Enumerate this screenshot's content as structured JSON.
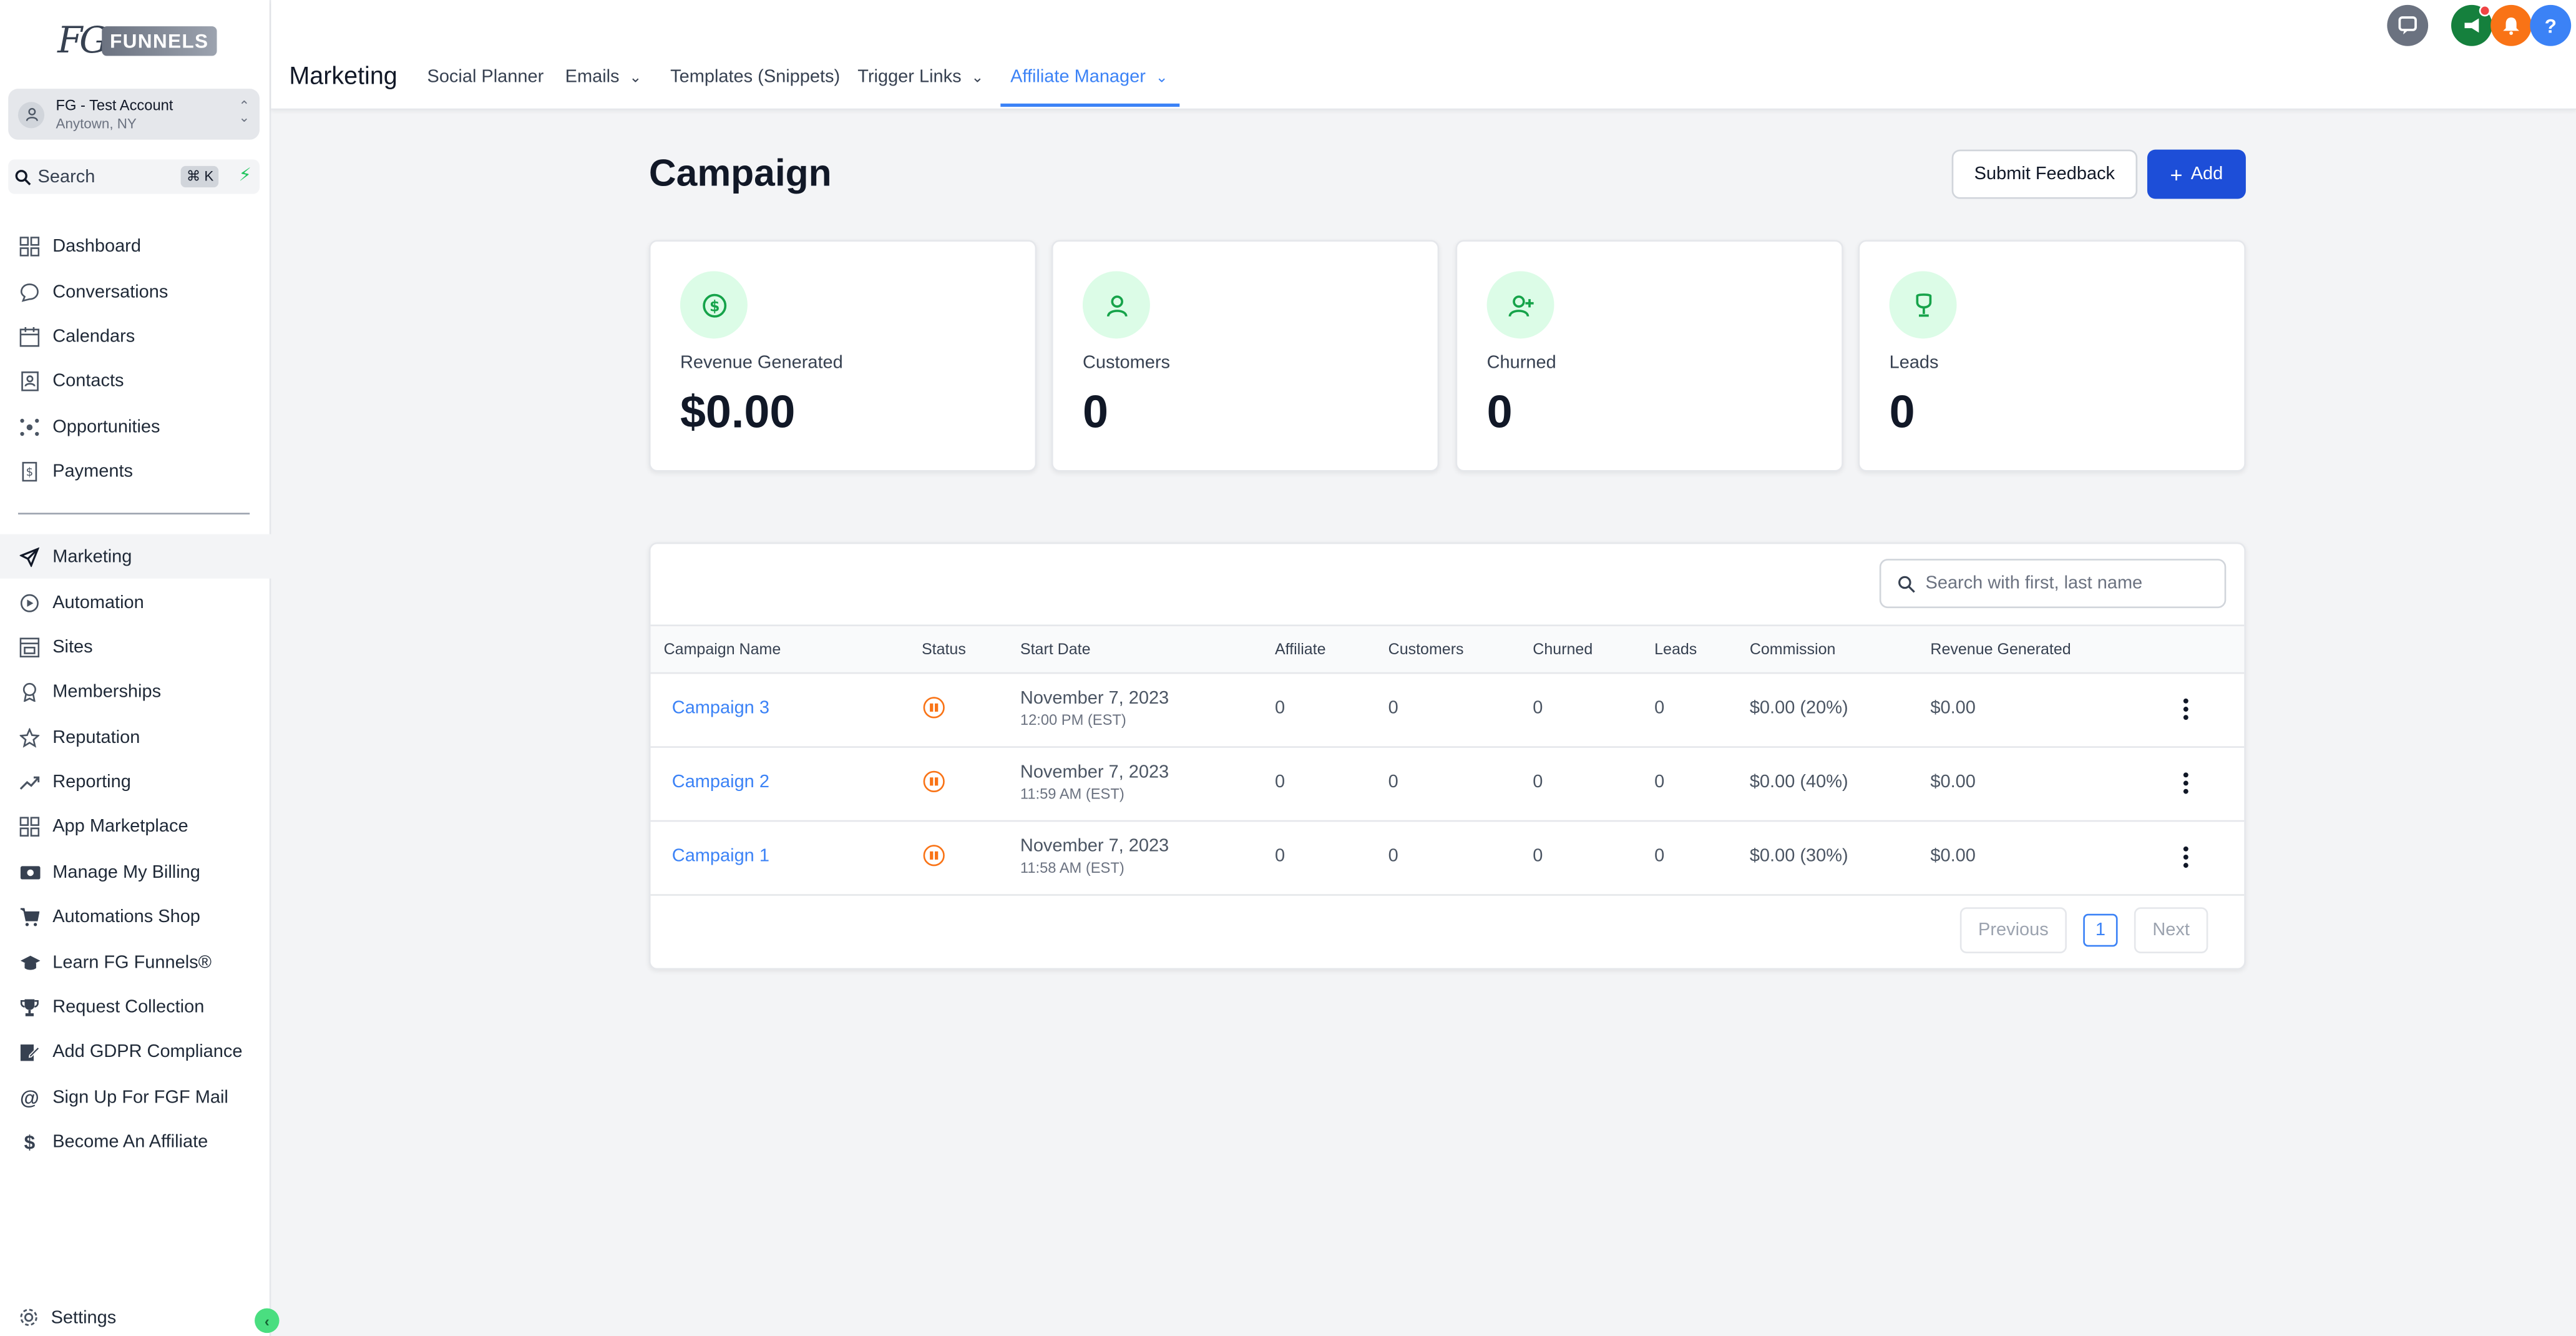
{
  "brand": {
    "logo_fg": "FG",
    "logo_funnels": "FUNNELS"
  },
  "account": {
    "name": "FG - Test Account",
    "location": "Anytown, NY"
  },
  "search": {
    "label": "Search",
    "shortcut": "⌘ K"
  },
  "sidebar": {
    "items": [
      {
        "label": "Dashboard",
        "icon": "dashboard-icon"
      },
      {
        "label": "Conversations",
        "icon": "chat-icon"
      },
      {
        "label": "Calendars",
        "icon": "calendar-icon"
      },
      {
        "label": "Contacts",
        "icon": "contacts-icon"
      },
      {
        "label": "Opportunities",
        "icon": "opportunities-icon"
      },
      {
        "label": "Payments",
        "icon": "payments-icon"
      },
      {
        "label": "Marketing",
        "icon": "send-icon",
        "active": true
      },
      {
        "label": "Automation",
        "icon": "automation-icon"
      },
      {
        "label": "Sites",
        "icon": "sites-icon"
      },
      {
        "label": "Memberships",
        "icon": "membership-icon"
      },
      {
        "label": "Reputation",
        "icon": "star-icon"
      },
      {
        "label": "Reporting",
        "icon": "trend-icon"
      },
      {
        "label": "App Marketplace",
        "icon": "apps-icon"
      },
      {
        "label": "Manage My Billing",
        "icon": "billing-icon"
      },
      {
        "label": "Automations Shop",
        "icon": "cart-icon"
      },
      {
        "label": "Learn FG Funnels®",
        "icon": "graduation-icon"
      },
      {
        "label": "Request Collection",
        "icon": "trophy-icon"
      },
      {
        "label": "Add GDPR Compliance",
        "icon": "edit-icon"
      },
      {
        "label": "Sign Up For FGF Mail",
        "icon": "at-icon"
      },
      {
        "label": "Become An Affiliate",
        "icon": "dollar-icon"
      }
    ],
    "settings": "Settings"
  },
  "topbar": {
    "section": "Marketing",
    "tabs": [
      {
        "label": "Social Planner"
      },
      {
        "label": "Emails"
      },
      {
        "label": "Templates (Snippets)"
      },
      {
        "label": "Trigger Links"
      },
      {
        "label": "Affiliate Manager",
        "active": true
      }
    ],
    "help": "?"
  },
  "page": {
    "title": "Campaign",
    "feedback_button": "Submit Feedback",
    "add_button": "Add"
  },
  "stats": [
    {
      "label": "Revenue Generated",
      "value": "$0.00",
      "icon": "dollar-circle-icon"
    },
    {
      "label": "Customers",
      "value": "0",
      "icon": "user-icon"
    },
    {
      "label": "Churned",
      "value": "0",
      "icon": "user-plus-icon"
    },
    {
      "label": "Leads",
      "value": "0",
      "icon": "lead-icon"
    }
  ],
  "table": {
    "search_placeholder": "Search with first, last name",
    "columns": [
      "Campaign Name",
      "Status",
      "Start Date",
      "Affiliate",
      "Customers",
      "Churned",
      "Leads",
      "Commission",
      "Revenue Generated"
    ],
    "rows": [
      {
        "name": "Campaign 3",
        "date": "November 7, 2023",
        "time": "12:00 PM (EST)",
        "affiliate": "0",
        "customers": "0",
        "churned": "0",
        "leads": "0",
        "commission": "$0.00 (20%)",
        "revenue": "$0.00"
      },
      {
        "name": "Campaign 2",
        "date": "November 7, 2023",
        "time": "11:59 AM (EST)",
        "affiliate": "0",
        "customers": "0",
        "churned": "0",
        "leads": "0",
        "commission": "$0.00 (40%)",
        "revenue": "$0.00"
      },
      {
        "name": "Campaign 1",
        "date": "November 7, 2023",
        "time": "11:58 AM (EST)",
        "affiliate": "0",
        "customers": "0",
        "churned": "0",
        "leads": "0",
        "commission": "$0.00 (30%)",
        "revenue": "$0.00"
      }
    ],
    "pager": {
      "previous": "Previous",
      "page": "1",
      "next": "Next"
    }
  },
  "colors": {
    "accent": "#3b82f6",
    "primary_button": "#1d4ed8",
    "status_paused": "#f97316",
    "icon_bg": "#dcfce7"
  }
}
